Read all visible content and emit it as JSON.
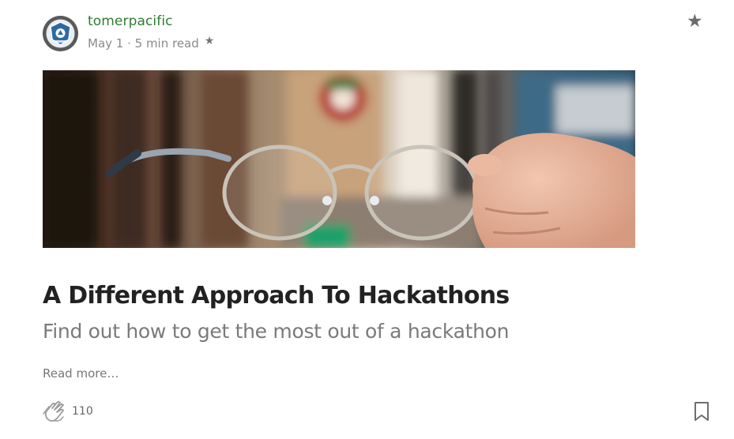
{
  "post": {
    "author": "tomerpacific",
    "meta": "May 1 · 5 min read",
    "title": "A Different Approach To Hackathons",
    "subtitle": "Find out how to get the most out of a hackathon",
    "read_more": "Read more…",
    "clap_count": "110"
  },
  "icons": {
    "avatar": "avatar-logo",
    "meta_star": "star-icon",
    "top_star": "star-icon",
    "clap": "clap-icon",
    "bookmark": "bookmark-icon"
  },
  "colors": {
    "author": "#2e7d32",
    "title": "#222222",
    "subtitle": "#7a7a7a",
    "meta": "#8a8a8a"
  }
}
